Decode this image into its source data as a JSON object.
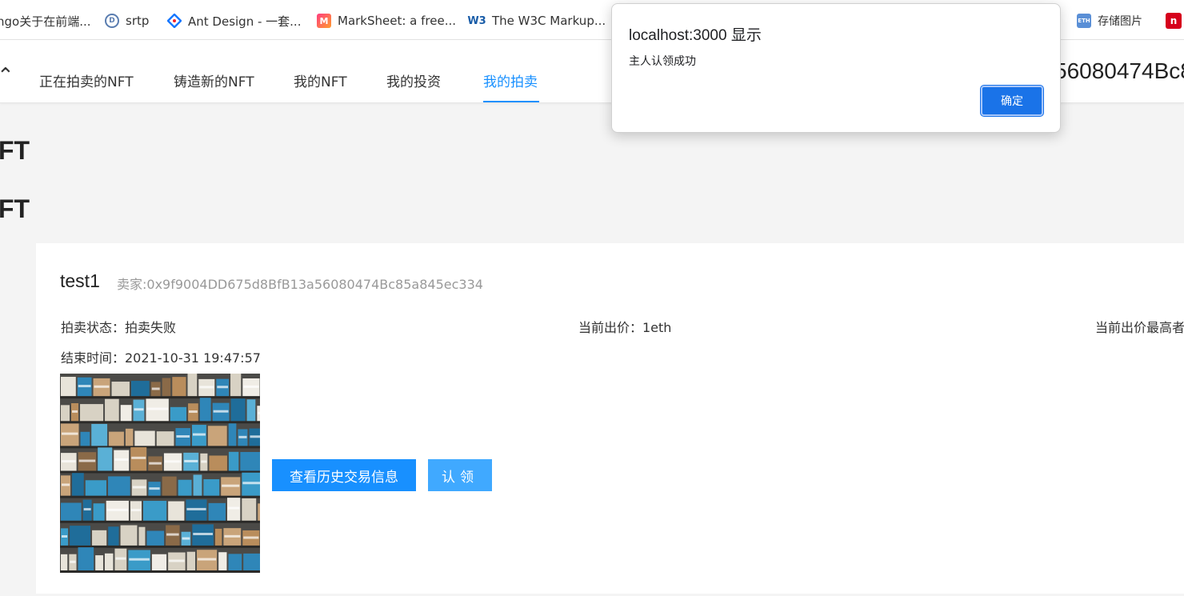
{
  "bookmarks": [
    {
      "label": "ngo关于在前端...",
      "icon": "page-icon"
    },
    {
      "label": "srtp",
      "icon": "srtp-icon"
    },
    {
      "label": "Ant Design - 一套...",
      "icon": "ant-design-icon"
    },
    {
      "label": "MarkSheet: a free...",
      "icon": "marksheet-icon"
    },
    {
      "label": "The W3C Markup...",
      "icon": "w3c-icon"
    },
    {
      "label": "存储图片",
      "icon": "eth-icon"
    }
  ],
  "nav": {
    "items": [
      "正在拍卖的NFT",
      "铸造新的NFT",
      "我的NFT",
      "我的投资",
      "我的拍卖"
    ],
    "active_index": 4,
    "account": "56080474Bc8"
  },
  "sections": [
    "FT",
    "FT"
  ],
  "card": {
    "title": "test1",
    "seller": "卖家:0x9f9004DD675d8BfB13a56080474Bc85a845ec334",
    "status": "拍卖状态：拍卖失败",
    "current_bid": "当前出价：1eth",
    "highest_bidder": "当前出价最高者",
    "end_time": "结束时间：2021-10-31 19:47:57",
    "history_button": "查看历史交易信息",
    "claim_button": "认领"
  },
  "dialog": {
    "title": "localhost:3000 显示",
    "message": "主人认领成功",
    "ok": "确定"
  },
  "colors": {
    "accent": "#1890ff",
    "dialog_button": "#1a73e8"
  }
}
